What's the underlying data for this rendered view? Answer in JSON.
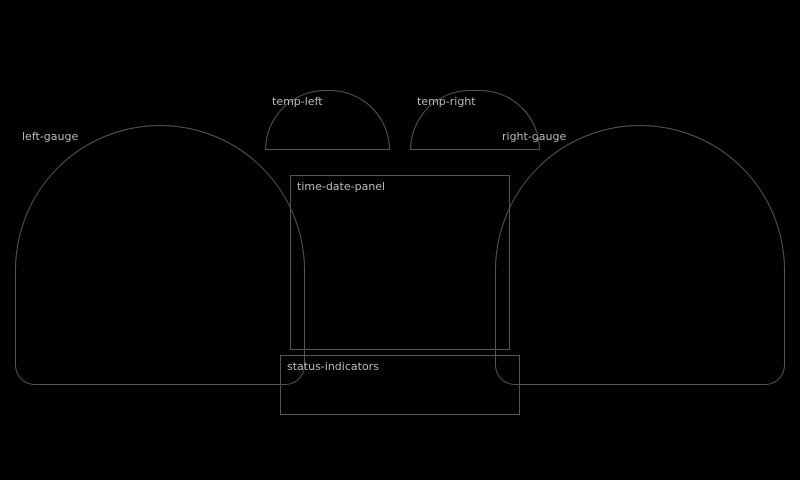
{
  "left_gauge": {},
  "right_gauge": {},
  "temp_gauges": [],
  "center": {},
  "indicators": {}
}
